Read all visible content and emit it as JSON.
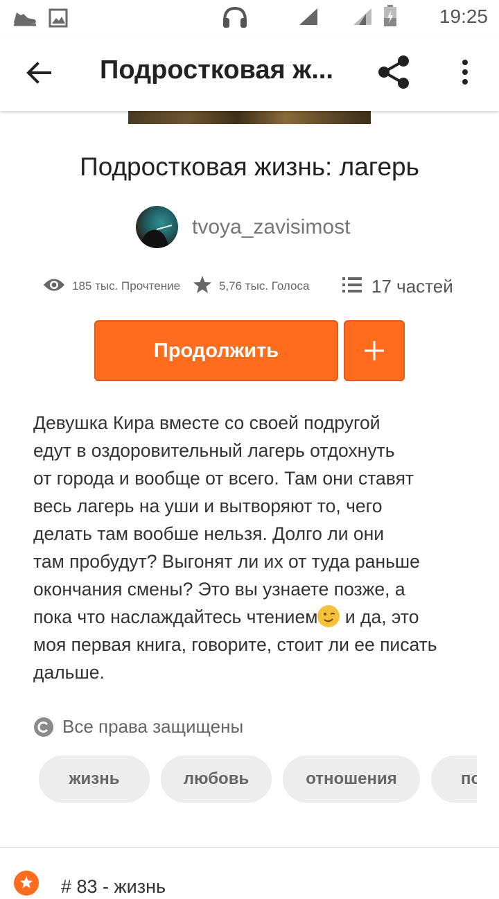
{
  "status_bar": {
    "time": "19:25",
    "icons": [
      "sneaker-icon",
      "image-icon",
      "headset-icon",
      "signal-icon",
      "signal-icon",
      "battery-charging-icon"
    ]
  },
  "toolbar": {
    "title": "Подростковая ж...",
    "icons": [
      "back-arrow-icon",
      "share-icon",
      "more-vert-icon"
    ]
  },
  "story": {
    "title": "Подростковая жизнь: лагерь",
    "author": "tvoya_zavisimost",
    "stats": {
      "reads": "185 тыс. Прочтение",
      "votes": "5,76 тыс. Голоса",
      "parts": "17 частей"
    },
    "continue_label": "Продолжить",
    "add_label": "+",
    "description_lines": [
      "Девушка Кира вместе со своей подругой",
      "едут в оздоровительный лагерь отдохнуть",
      "от города и вообще от всего. Там они ставят",
      "весь лагерь на уши и вытворяют то, чего",
      "делать там вообше нельзя. Долго ли они",
      "там пробудут? Выгонят ли их от туда раньше",
      "окончания смены? Это вы узнаете позже, а",
      "пока что наслаждайтесь чтением",
      "и да, это",
      "моя первая книга, говорите, стоит ли ее писать",
      "дальше."
    ],
    "copyright": "Все права защищены",
    "tags": [
      "жизнь",
      "любовь",
      "отношения",
      "под"
    ]
  },
  "bottom_item": {
    "text": "# 83 - жизнь"
  },
  "colors": {
    "accent": "#ff6c1e",
    "tag_bg": "#ededed"
  }
}
